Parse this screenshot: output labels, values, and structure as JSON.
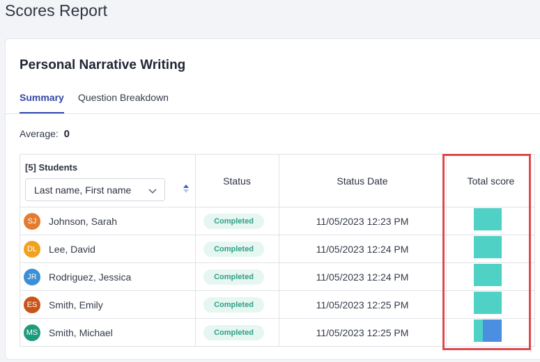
{
  "page": {
    "title": "Scores Report"
  },
  "assignment": {
    "title": "Personal Narrative Writing"
  },
  "tabs": [
    {
      "label": "Summary",
      "active": true
    },
    {
      "label": "Question Breakdown",
      "active": false
    }
  ],
  "average": {
    "label": "Average:",
    "value": "0"
  },
  "table": {
    "students_header": "[5] Students",
    "sort_select": "Last name, First name",
    "status_header": "Status",
    "status_date_header": "Status Date",
    "total_score_header": "Total score",
    "rows": [
      {
        "initials": "SJ",
        "avatar_color": "#e57b2f",
        "name": "Johnson, Sarah",
        "status": "Completed",
        "date": "11/05/2023 12:23 PM",
        "score_fill": 1.0,
        "score_split": 1.0
      },
      {
        "initials": "DL",
        "avatar_color": "#f0a21e",
        "name": "Lee, David",
        "status": "Completed",
        "date": "11/05/2023 12:24 PM",
        "score_fill": 1.0,
        "score_split": 1.0
      },
      {
        "initials": "JR",
        "avatar_color": "#3b8fd6",
        "name": "Rodriguez, Jessica",
        "status": "Completed",
        "date": "11/05/2023 12:24 PM",
        "score_fill": 1.0,
        "score_split": 1.0
      },
      {
        "initials": "ES",
        "avatar_color": "#c9551a",
        "name": "Smith, Emily",
        "status": "Completed",
        "date": "11/05/2023 12:25 PM",
        "score_fill": 1.0,
        "score_split": 1.0
      },
      {
        "initials": "MS",
        "avatar_color": "#1f9a7a",
        "name": "Smith, Michael",
        "status": "Completed",
        "date": "11/05/2023 12:25 PM",
        "score_fill": 1.0,
        "score_split": 0.33
      }
    ]
  },
  "colors": {
    "score_primary": "#4fd1c5",
    "score_secondary": "#4a8fe0",
    "accent": "#3347a8",
    "highlight": "#e0484d"
  },
  "icons": {
    "sort_select": "chevron-down-icon",
    "sort_order": "sort-arrows-icon"
  }
}
